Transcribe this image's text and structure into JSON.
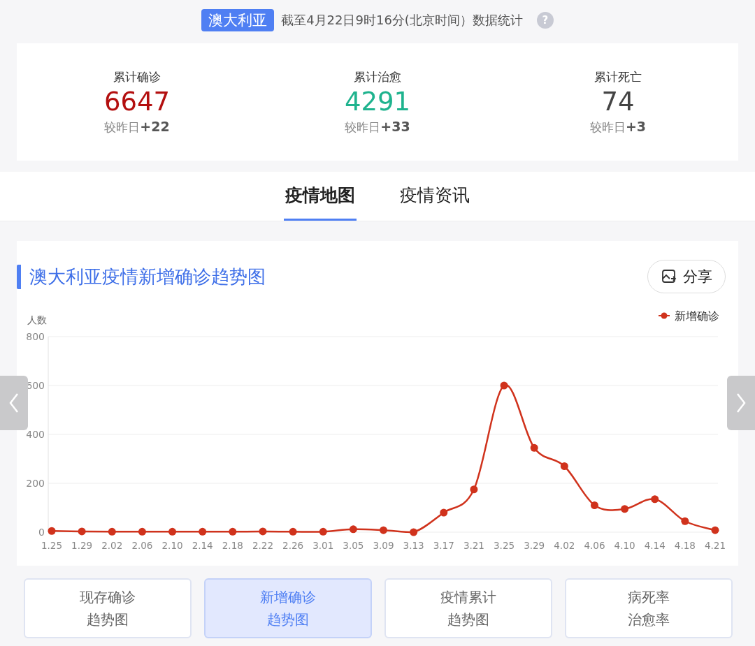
{
  "header": {
    "region": "澳大利亚",
    "caption": "截至4月22日9时16分(北京时间）数据统计",
    "help": "?"
  },
  "stats": [
    {
      "label": "累计确诊",
      "value": "6647",
      "color": "#b30f0f",
      "delta_label": "较昨日",
      "delta": "+22"
    },
    {
      "label": "累计治愈",
      "value": "4291",
      "color": "#1fb38e",
      "delta_label": "较昨日",
      "delta": "+33"
    },
    {
      "label": "累计死亡",
      "value": "74",
      "color": "#444444",
      "delta_label": "较昨日",
      "delta": "+3"
    }
  ],
  "tabs": [
    {
      "label": "疫情地图",
      "selected": true
    },
    {
      "label": "疫情资讯",
      "selected": false
    }
  ],
  "chart_card": {
    "title": "澳大利亚疫情新增确诊趋势图",
    "share": "分享",
    "chart_data": {
      "type": "line",
      "ylabel": "人数",
      "categories": [
        "1.25",
        "1.29",
        "2.02",
        "2.06",
        "2.10",
        "2.14",
        "2.18",
        "2.22",
        "2.26",
        "3.01",
        "3.05",
        "3.09",
        "3.13",
        "3.17",
        "3.21",
        "3.25",
        "3.29",
        "4.02",
        "4.06",
        "4.10",
        "4.14",
        "4.18",
        "4.21"
      ],
      "series": [
        {
          "name": "新增确诊",
          "color": "#d0321c",
          "values": [
            5,
            3,
            2,
            2,
            2,
            2,
            2,
            3,
            2,
            2,
            12,
            8,
            0,
            80,
            175,
            600,
            345,
            270,
            110,
            95,
            135,
            45,
            8
          ]
        }
      ],
      "ylim": [
        0,
        800
      ],
      "yticks": [
        0,
        200,
        400,
        600,
        800
      ],
      "grid": true,
      "marker": true
    }
  },
  "trend_buttons": [
    {
      "lines": [
        "现存确诊",
        "趋势图"
      ],
      "selected": false
    },
    {
      "lines": [
        "新增确诊",
        "趋势图"
      ],
      "selected": true
    },
    {
      "lines": [
        "疫情累计",
        "趋势图"
      ],
      "selected": false
    },
    {
      "lines": [
        "病死率",
        "治愈率"
      ],
      "selected": false
    }
  ]
}
